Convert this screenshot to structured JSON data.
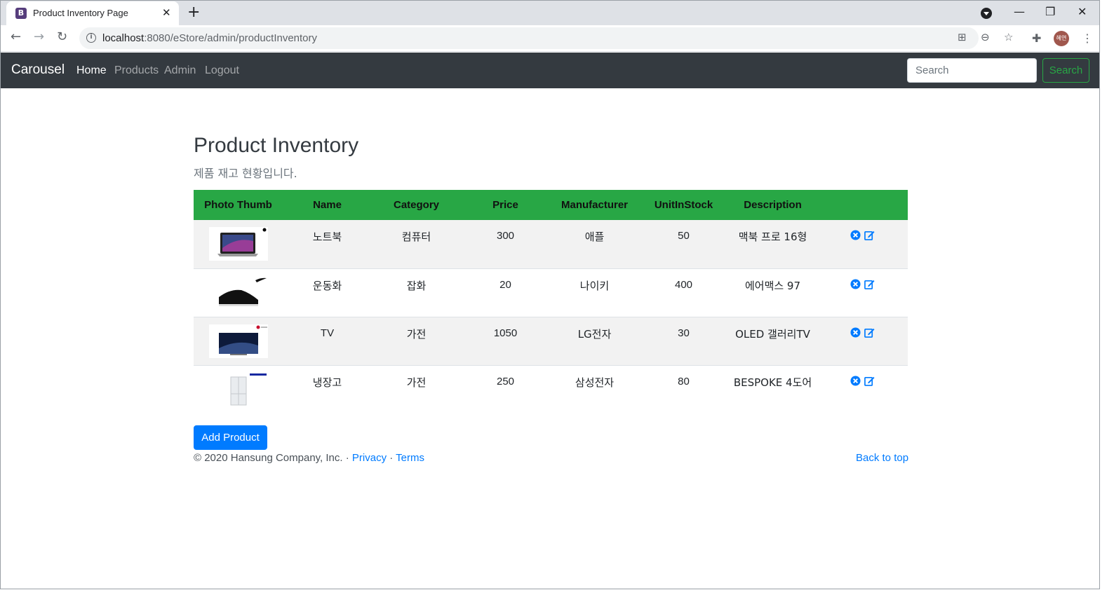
{
  "browser": {
    "tab_title": "Product Inventory Page",
    "tab_favicon": "B",
    "url_host": "localhost",
    "url_rest": ":8080/eStore/admin/productInventory",
    "profile_label": "혜연"
  },
  "navbar": {
    "brand": "Carousel",
    "links": [
      "Home",
      "Products",
      "Admin",
      "Logout"
    ],
    "search_placeholder": "Search",
    "search_button": "Search"
  },
  "page": {
    "title": "Product Inventory",
    "subtitle": "제품 재고 현황입니다."
  },
  "table": {
    "headers": [
      "Photo Thumb",
      "Name",
      "Category",
      "Price",
      "Manufacturer",
      "UnitInStock",
      "Description",
      ""
    ],
    "rows": [
      {
        "name": "노트북",
        "category": "컴퓨터",
        "price": "300",
        "manufacturer": "애플",
        "stock": "50",
        "description": "맥북 프로 16형",
        "thumb": "laptop"
      },
      {
        "name": "운동화",
        "category": "잡화",
        "price": "20",
        "manufacturer": "나이키",
        "stock": "400",
        "description": "에어맥스 97",
        "thumb": "sneaker"
      },
      {
        "name": "TV",
        "category": "가전",
        "price": "1050",
        "manufacturer": "LG전자",
        "stock": "30",
        "description": "OLED 갤러리TV",
        "thumb": "tv"
      },
      {
        "name": "냉장고",
        "category": "가전",
        "price": "250",
        "manufacturer": "삼성전자",
        "stock": "80",
        "description": "BESPOKE 4도어",
        "thumb": "fridge"
      }
    ]
  },
  "actions": {
    "add_button": "Add Product"
  },
  "footer": {
    "copyright": "© 2020 Hansung Company, Inc. · ",
    "privacy": "Privacy",
    "sep": " · ",
    "terms": "Terms",
    "back_to_top": "Back to top"
  },
  "colors": {
    "navbar_bg": "#343a40",
    "table_header": "#28a745",
    "primary": "#007bff"
  }
}
